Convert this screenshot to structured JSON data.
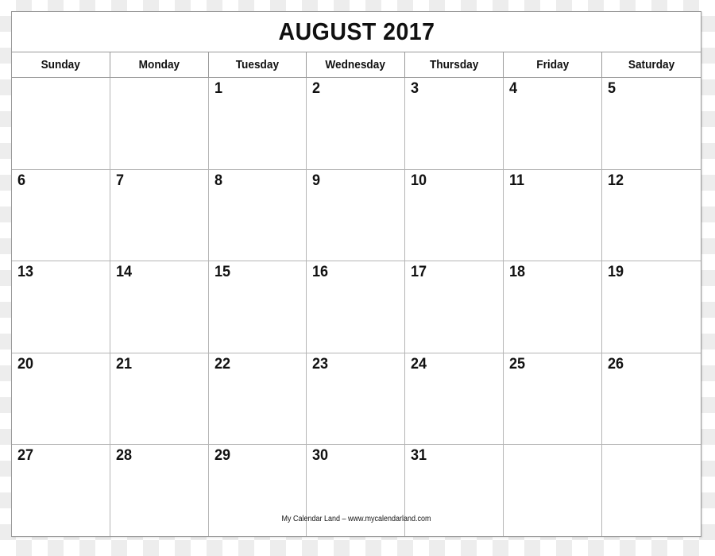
{
  "document": {
    "type": "printable-monthly-calendar",
    "title": "AUGUST 2017",
    "month": "AUGUST",
    "year": "2017"
  },
  "weekday_headers": [
    {
      "label": "Sunday"
    },
    {
      "label": "Monday"
    },
    {
      "label": "Tuesday"
    },
    {
      "label": "Wednesday"
    },
    {
      "label": "Thursday"
    },
    {
      "label": "Friday"
    },
    {
      "label": "Saturday"
    }
  ],
  "weeks": [
    {
      "days": [
        {
          "number": ""
        },
        {
          "number": ""
        },
        {
          "number": "1"
        },
        {
          "number": "2"
        },
        {
          "number": "3"
        },
        {
          "number": "4"
        },
        {
          "number": "5"
        }
      ]
    },
    {
      "days": [
        {
          "number": "6"
        },
        {
          "number": "7"
        },
        {
          "number": "8"
        },
        {
          "number": "9"
        },
        {
          "number": "10"
        },
        {
          "number": "11"
        },
        {
          "number": "12"
        }
      ]
    },
    {
      "days": [
        {
          "number": "13"
        },
        {
          "number": "14"
        },
        {
          "number": "15"
        },
        {
          "number": "16"
        },
        {
          "number": "17"
        },
        {
          "number": "18"
        },
        {
          "number": "19"
        }
      ]
    },
    {
      "days": [
        {
          "number": "20"
        },
        {
          "number": "21"
        },
        {
          "number": "22"
        },
        {
          "number": "23"
        },
        {
          "number": "24"
        },
        {
          "number": "25"
        },
        {
          "number": "26"
        }
      ]
    },
    {
      "days": [
        {
          "number": "27"
        },
        {
          "number": "28"
        },
        {
          "number": "29"
        },
        {
          "number": "30"
        },
        {
          "number": "31"
        },
        {
          "number": ""
        },
        {
          "number": ""
        }
      ]
    }
  ],
  "footer": {
    "credit": "My Calendar Land – www.mycalendarland.com"
  },
  "colors": {
    "paper": "#ffffff",
    "outer_border": "#9a9a9a",
    "grid_line": "#b5b5b5",
    "text": "#111111",
    "checker_light": "#ffffff",
    "checker_gray": "#ededed"
  }
}
